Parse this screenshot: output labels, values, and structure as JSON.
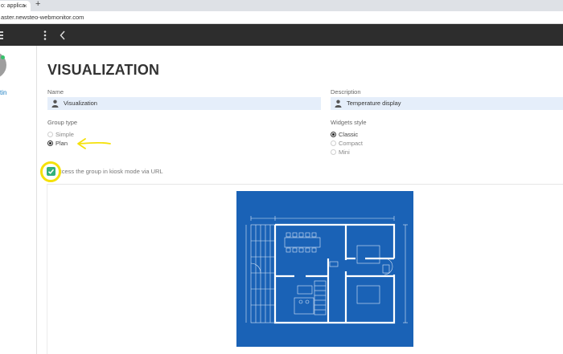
{
  "browser": {
    "tab_title": "o: applica",
    "tab_close": "×",
    "new_tab": "+",
    "url": "aster.newsteo-webmonitor.com"
  },
  "sidebar": {
    "username": "tin"
  },
  "page": {
    "title": "VISUALIZATION"
  },
  "form": {
    "name_label": "Name",
    "name_value": "Visualization",
    "description_label": "Description",
    "description_value": "Temperature display",
    "group_type_label": "Group type",
    "group_type_options": [
      "Simple",
      "Plan"
    ],
    "group_type_selected": "Plan",
    "widgets_style_label": "Widgets style",
    "widgets_style_options": [
      "Classic",
      "Compact",
      "Mini"
    ],
    "widgets_style_selected": "Classic",
    "kiosk_label": "ccess the group in kiosk mode via URL",
    "kiosk_checked": true
  },
  "icons": {
    "app_logo": "app-logo-icon",
    "menu": "kebab-menu-icon",
    "back": "chevron-left-icon",
    "field_user": "person-icon",
    "check": "check-icon"
  },
  "colors": {
    "header_bg": "#2d2d2d",
    "field_bg": "#e5eefa",
    "check_green": "#33b07a",
    "annotation_yellow": "#f5e10a",
    "plan_blue": "#1a62b6",
    "online_green": "#36c26b"
  }
}
